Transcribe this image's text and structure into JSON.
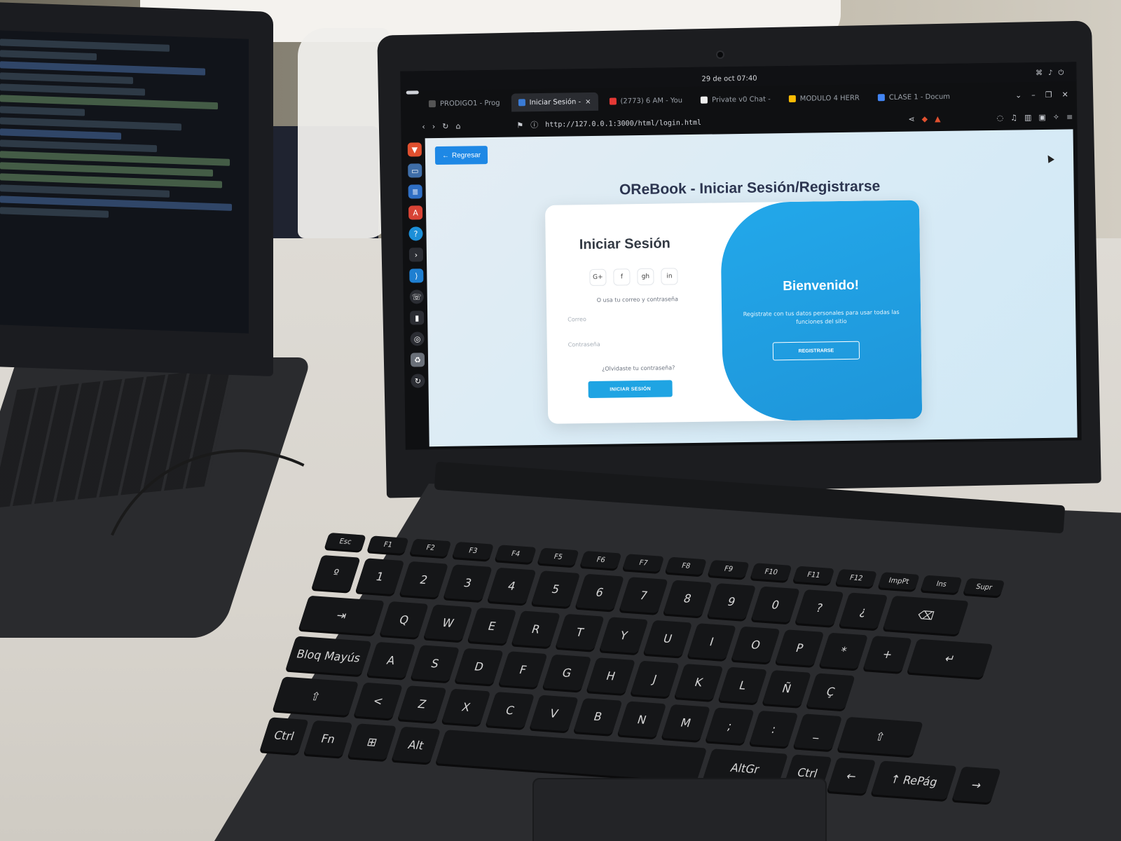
{
  "topbar": {
    "clock": "29 de oct  07:40"
  },
  "tabs": [
    {
      "label": "PRODIGO1 - Prog",
      "color": "#555"
    },
    {
      "label": "Iniciar Sesión -",
      "color": "#3a7bd5",
      "active": true
    },
    {
      "label": "(2773) 6 AM - You",
      "color": "#e53935"
    },
    {
      "label": "Private v0 Chat -",
      "color": "#eeeeee"
    },
    {
      "label": "MODULO 4 HERR",
      "color": "#fbbc04"
    },
    {
      "label": "CLASE 1 - Docum",
      "color": "#4285f4"
    }
  ],
  "browser": {
    "url": "http://127.0.0.1:3000/html/login.html"
  },
  "page": {
    "back_label": "Regresar",
    "title": "OReBook - Iniciar Sesión/Registrarse",
    "login": {
      "title": "Iniciar Sesión",
      "socials": [
        "G+",
        "f",
        "gh",
        "in"
      ],
      "alt_text": "O usa tu correo y contraseña",
      "email_placeholder": "Correo",
      "password_placeholder": "Contraseña",
      "forgot": "¿Olvidaste tu contraseña?",
      "submit": "INICIAR SESIÓN"
    },
    "welcome": {
      "title": "Bienvenido!",
      "text": "Registrate con tus datos personales para usar todas las funciones del sitio",
      "register": "REGISTRARSE"
    }
  },
  "keyboard": {
    "row1": [
      "Esc",
      "F1",
      "F2",
      "F3",
      "F4",
      "F5",
      "F6",
      "F7",
      "F8",
      "F9",
      "F10",
      "F11",
      "F12",
      "ImpPt",
      "Ins",
      "Supr"
    ],
    "row2": [
      "º",
      "1",
      "2",
      "3",
      "4",
      "5",
      "6",
      "7",
      "8",
      "9",
      "0",
      "?",
      "¿",
      "⌫"
    ],
    "row3": [
      "⇥",
      "Q",
      "W",
      "E",
      "R",
      "T",
      "Y",
      "U",
      "I",
      "O",
      "P",
      "*",
      "+",
      "↵"
    ],
    "row4": [
      "Bloq Mayús",
      "A",
      "S",
      "D",
      "F",
      "G",
      "H",
      "J",
      "K",
      "L",
      "Ñ",
      "Ç"
    ],
    "row5": [
      "⇧",
      "<",
      "Z",
      "X",
      "C",
      "V",
      "B",
      "N",
      "M",
      ";",
      ":",
      "_",
      "⇧"
    ],
    "row6": [
      "Ctrl",
      "Fn",
      "⊞",
      "Alt",
      "",
      "AltGr",
      "Ctrl",
      "←",
      "↑ RePág",
      "→"
    ]
  },
  "colors": {
    "accent": "#1e88e5",
    "welcome_bg": "#23a8ea"
  }
}
